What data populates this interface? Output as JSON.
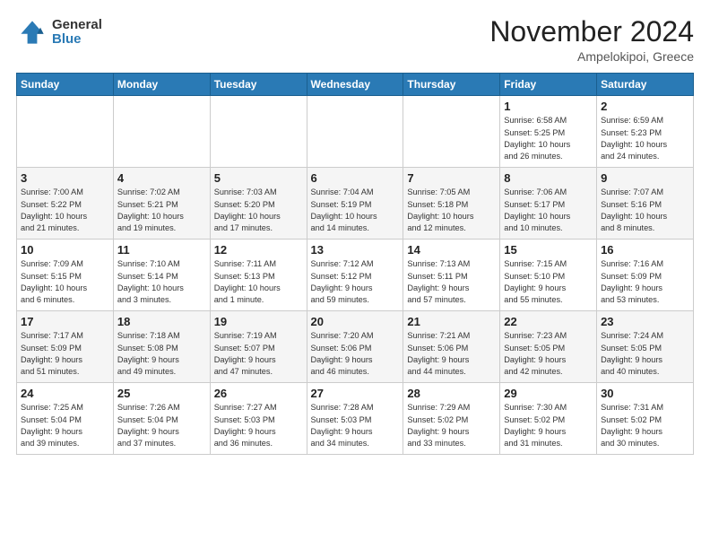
{
  "logo": {
    "general": "General",
    "blue": "Blue"
  },
  "title": "November 2024",
  "location": "Ampelokipoi, Greece",
  "days_header": [
    "Sunday",
    "Monday",
    "Tuesday",
    "Wednesday",
    "Thursday",
    "Friday",
    "Saturday"
  ],
  "weeks": [
    [
      {
        "day": "",
        "info": ""
      },
      {
        "day": "",
        "info": ""
      },
      {
        "day": "",
        "info": ""
      },
      {
        "day": "",
        "info": ""
      },
      {
        "day": "",
        "info": ""
      },
      {
        "day": "1",
        "info": "Sunrise: 6:58 AM\nSunset: 5:25 PM\nDaylight: 10 hours\nand 26 minutes."
      },
      {
        "day": "2",
        "info": "Sunrise: 6:59 AM\nSunset: 5:23 PM\nDaylight: 10 hours\nand 24 minutes."
      }
    ],
    [
      {
        "day": "3",
        "info": "Sunrise: 7:00 AM\nSunset: 5:22 PM\nDaylight: 10 hours\nand 21 minutes."
      },
      {
        "day": "4",
        "info": "Sunrise: 7:02 AM\nSunset: 5:21 PM\nDaylight: 10 hours\nand 19 minutes."
      },
      {
        "day": "5",
        "info": "Sunrise: 7:03 AM\nSunset: 5:20 PM\nDaylight: 10 hours\nand 17 minutes."
      },
      {
        "day": "6",
        "info": "Sunrise: 7:04 AM\nSunset: 5:19 PM\nDaylight: 10 hours\nand 14 minutes."
      },
      {
        "day": "7",
        "info": "Sunrise: 7:05 AM\nSunset: 5:18 PM\nDaylight: 10 hours\nand 12 minutes."
      },
      {
        "day": "8",
        "info": "Sunrise: 7:06 AM\nSunset: 5:17 PM\nDaylight: 10 hours\nand 10 minutes."
      },
      {
        "day": "9",
        "info": "Sunrise: 7:07 AM\nSunset: 5:16 PM\nDaylight: 10 hours\nand 8 minutes."
      }
    ],
    [
      {
        "day": "10",
        "info": "Sunrise: 7:09 AM\nSunset: 5:15 PM\nDaylight: 10 hours\nand 6 minutes."
      },
      {
        "day": "11",
        "info": "Sunrise: 7:10 AM\nSunset: 5:14 PM\nDaylight: 10 hours\nand 3 minutes."
      },
      {
        "day": "12",
        "info": "Sunrise: 7:11 AM\nSunset: 5:13 PM\nDaylight: 10 hours\nand 1 minute."
      },
      {
        "day": "13",
        "info": "Sunrise: 7:12 AM\nSunset: 5:12 PM\nDaylight: 9 hours\nand 59 minutes."
      },
      {
        "day": "14",
        "info": "Sunrise: 7:13 AM\nSunset: 5:11 PM\nDaylight: 9 hours\nand 57 minutes."
      },
      {
        "day": "15",
        "info": "Sunrise: 7:15 AM\nSunset: 5:10 PM\nDaylight: 9 hours\nand 55 minutes."
      },
      {
        "day": "16",
        "info": "Sunrise: 7:16 AM\nSunset: 5:09 PM\nDaylight: 9 hours\nand 53 minutes."
      }
    ],
    [
      {
        "day": "17",
        "info": "Sunrise: 7:17 AM\nSunset: 5:09 PM\nDaylight: 9 hours\nand 51 minutes."
      },
      {
        "day": "18",
        "info": "Sunrise: 7:18 AM\nSunset: 5:08 PM\nDaylight: 9 hours\nand 49 minutes."
      },
      {
        "day": "19",
        "info": "Sunrise: 7:19 AM\nSunset: 5:07 PM\nDaylight: 9 hours\nand 47 minutes."
      },
      {
        "day": "20",
        "info": "Sunrise: 7:20 AM\nSunset: 5:06 PM\nDaylight: 9 hours\nand 46 minutes."
      },
      {
        "day": "21",
        "info": "Sunrise: 7:21 AM\nSunset: 5:06 PM\nDaylight: 9 hours\nand 44 minutes."
      },
      {
        "day": "22",
        "info": "Sunrise: 7:23 AM\nSunset: 5:05 PM\nDaylight: 9 hours\nand 42 minutes."
      },
      {
        "day": "23",
        "info": "Sunrise: 7:24 AM\nSunset: 5:05 PM\nDaylight: 9 hours\nand 40 minutes."
      }
    ],
    [
      {
        "day": "24",
        "info": "Sunrise: 7:25 AM\nSunset: 5:04 PM\nDaylight: 9 hours\nand 39 minutes."
      },
      {
        "day": "25",
        "info": "Sunrise: 7:26 AM\nSunset: 5:04 PM\nDaylight: 9 hours\nand 37 minutes."
      },
      {
        "day": "26",
        "info": "Sunrise: 7:27 AM\nSunset: 5:03 PM\nDaylight: 9 hours\nand 36 minutes."
      },
      {
        "day": "27",
        "info": "Sunrise: 7:28 AM\nSunset: 5:03 PM\nDaylight: 9 hours\nand 34 minutes."
      },
      {
        "day": "28",
        "info": "Sunrise: 7:29 AM\nSunset: 5:02 PM\nDaylight: 9 hours\nand 33 minutes."
      },
      {
        "day": "29",
        "info": "Sunrise: 7:30 AM\nSunset: 5:02 PM\nDaylight: 9 hours\nand 31 minutes."
      },
      {
        "day": "30",
        "info": "Sunrise: 7:31 AM\nSunset: 5:02 PM\nDaylight: 9 hours\nand 30 minutes."
      }
    ]
  ]
}
